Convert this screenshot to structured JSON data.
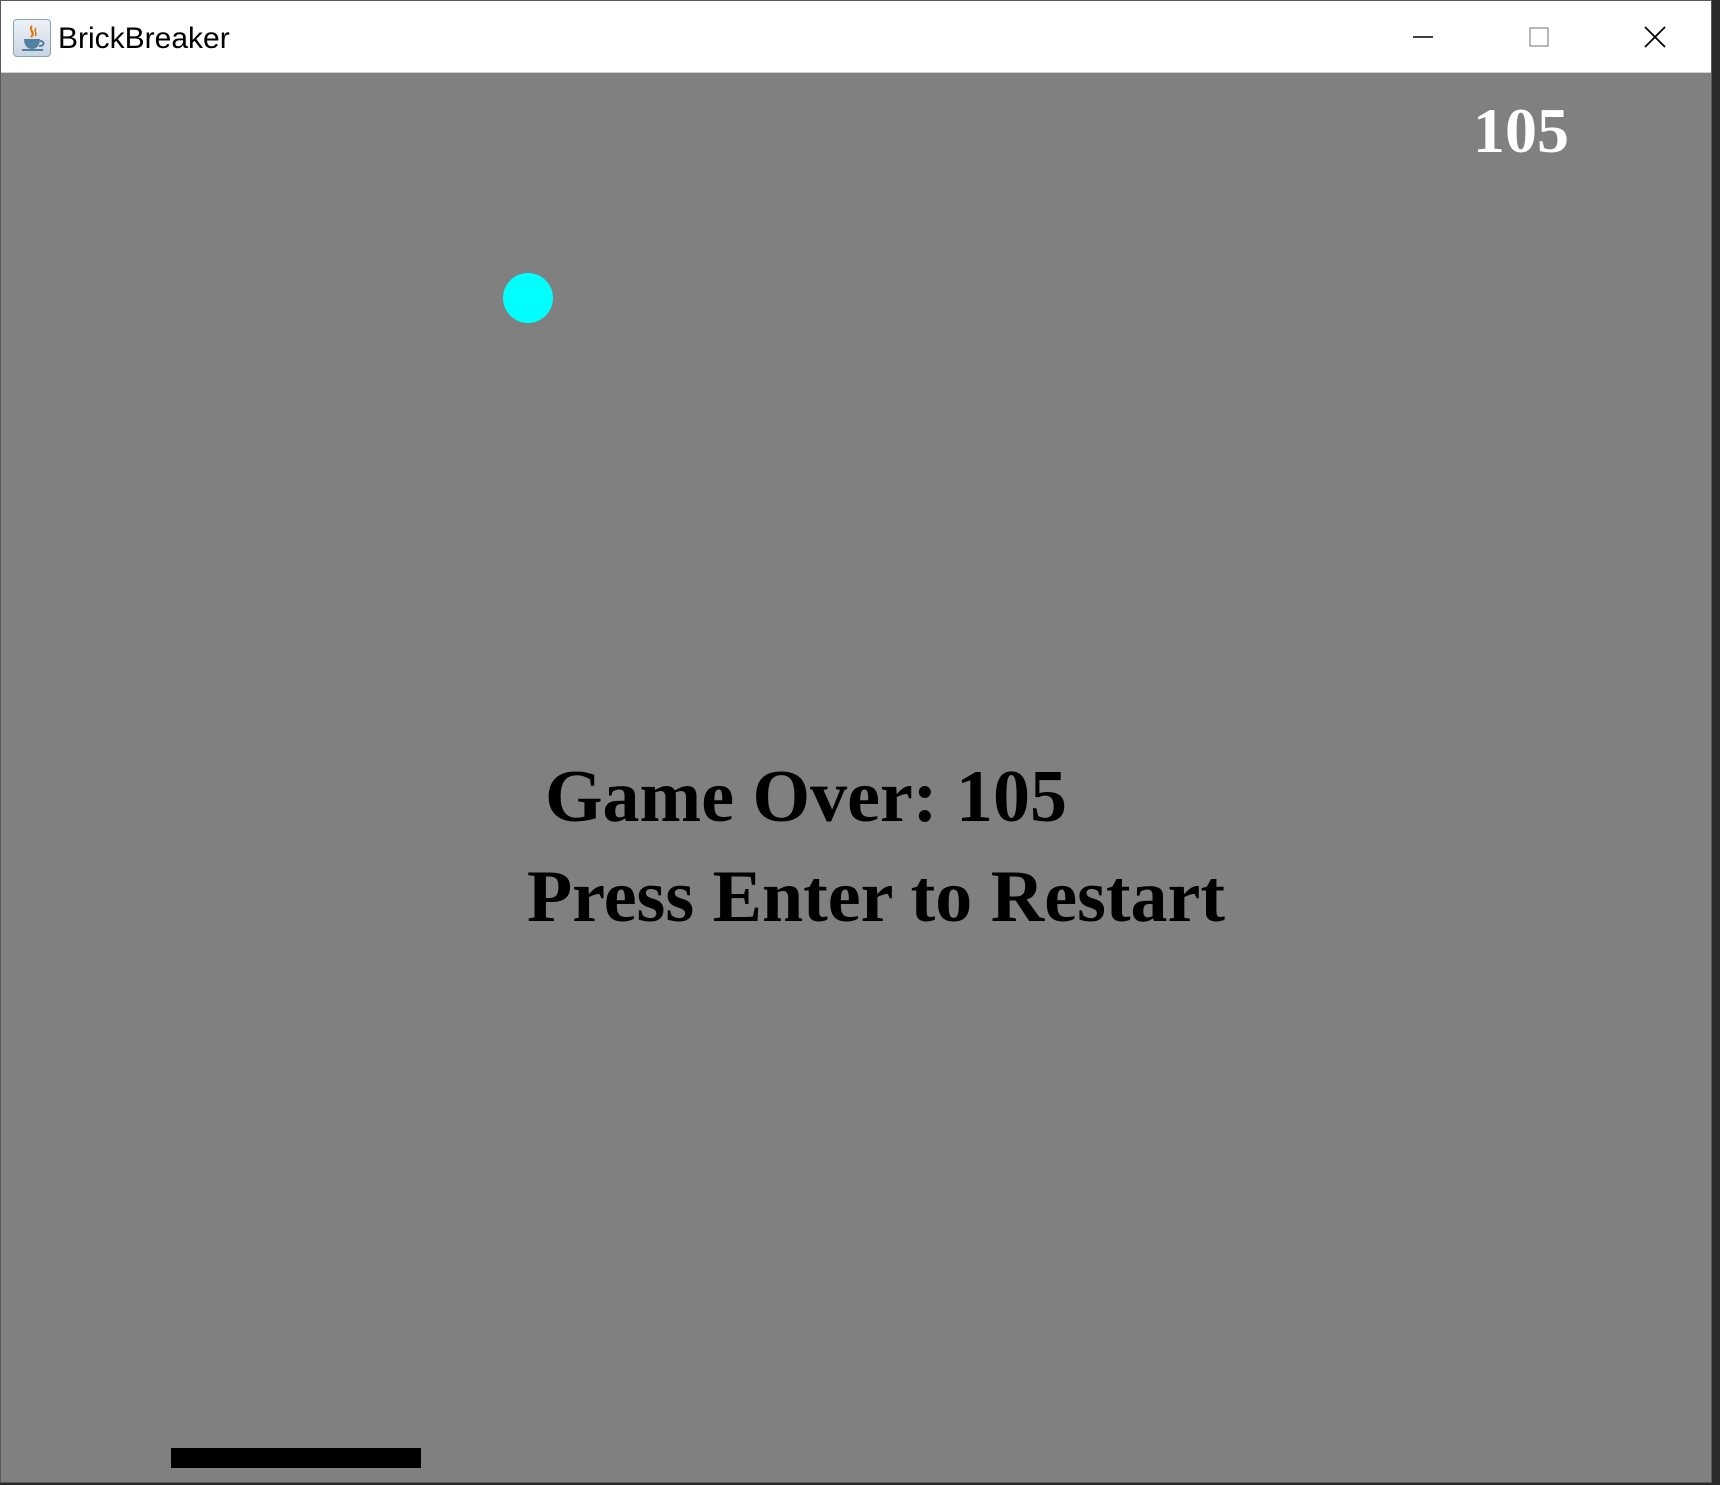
{
  "window": {
    "title": "BrickBreaker",
    "app_icon": "java-coffee-cup-icon",
    "controls": {
      "minimize_icon": "minimize-icon",
      "maximize_icon": "maximize-icon",
      "close_icon": "close-icon"
    }
  },
  "game": {
    "score": "105",
    "game_over_text": "Game Over: 105",
    "restart_text": "Press Enter to Restart",
    "colors": {
      "background": "#808080",
      "ball": "#00ffff",
      "paddle": "#000000",
      "score_text": "#ffffff",
      "message_text": "#000000"
    }
  }
}
